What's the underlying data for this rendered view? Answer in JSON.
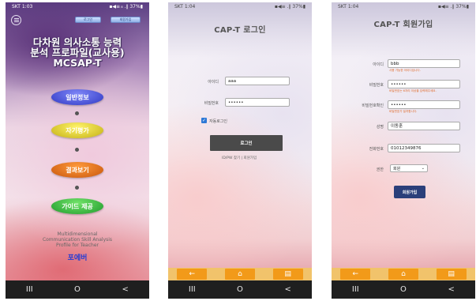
{
  "screens": {
    "main": {
      "status": {
        "left": "SKT 1:03",
        "right": "▪◀≡ ₈ .∥ 37%▮"
      },
      "top_buttons": {
        "login": "로그인",
        "signup": "회원가입"
      },
      "title_lines": [
        "다차원 의사소통 능력",
        "분석 프로파일(교사용)",
        "MCSAP-T"
      ],
      "menu": [
        "일반정보",
        "자기평가",
        "결과보기",
        "가이드 제공"
      ],
      "subtitle_lines": [
        "Multidimensional",
        "Communication Skill Analysis",
        "Profile for Teacher"
      ],
      "brand": "포에버",
      "nav": [
        "III",
        "O",
        "<"
      ]
    },
    "login": {
      "status": {
        "left": "SKT 1:04",
        "right": "▪◀≡ .∥ 37%▮"
      },
      "title": "CAP-T 로그인",
      "id_label": "아이디",
      "id_value": "aaa",
      "pw_label": "비밀번호",
      "pw_value": "••••••",
      "auto_login": "자동로그인",
      "login_button": "로그인",
      "links": "ID/PW 찾기   |   회원가입",
      "toolbar": [
        "←",
        "⌂",
        "▤"
      ],
      "nav": [
        "III",
        "O",
        "<"
      ]
    },
    "signup": {
      "status": {
        "left": "SKT 1:04",
        "right": "▪◀≡ .∥ 37%▮"
      },
      "title": "CAP-T 회원가입",
      "id_label": "아이디",
      "id_value": "bbb",
      "id_hint": "사용 가능한 아이디입니다.",
      "pw_label": "비밀번호",
      "pw_value": "••••••",
      "pw_hint": "비밀번호는 6자리 이상을 입력해주세요.",
      "pw2_label": "비밀번호확인",
      "pw2_value": "••••••",
      "pw2_hint": "비밀번호가 일치합니다.",
      "name_label": "성명",
      "name_value": "이동훈",
      "phone_label": "전화번호",
      "phone_value": "01012349876",
      "role_label": "권한",
      "role_value": "회원",
      "submit": "회원가입",
      "toolbar": [
        "←",
        "⌂",
        "▤"
      ],
      "nav": [
        "III",
        "O",
        "<"
      ]
    }
  }
}
